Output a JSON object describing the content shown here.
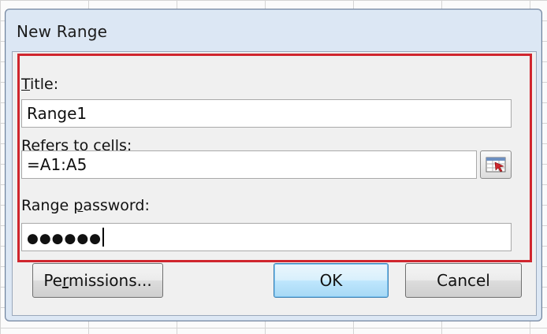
{
  "dialog": {
    "title": "New Range"
  },
  "fields": {
    "title_label_first": "T",
    "title_label_rest": "itle:",
    "title_value": "Range1",
    "refers_label_first": "R",
    "refers_label_rest": "efers to cells:",
    "refers_value": "=A1:A5",
    "password_label_pre": "Range ",
    "password_label_u": "p",
    "password_label_post": "assword:",
    "password_value": "●●●●●●"
  },
  "buttons": {
    "permissions_pre": "Pe",
    "permissions_u": "r",
    "permissions_post": "missions...",
    "ok": "OK",
    "cancel": "Cancel"
  },
  "icons": {
    "collapse": "collapse-dialog-icon"
  },
  "colors": {
    "highlight": "#d0262e",
    "dialog_frame": "#dce7f4"
  }
}
